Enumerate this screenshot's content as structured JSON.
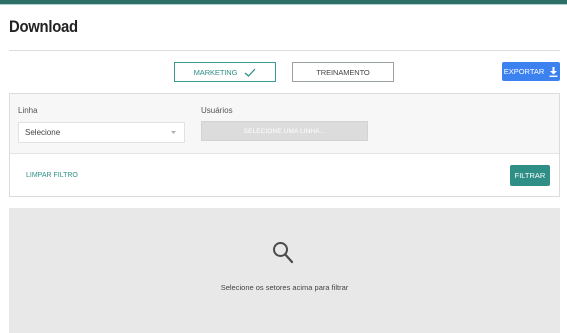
{
  "header": {
    "title": "Download"
  },
  "tabs": [
    {
      "label": "MARKETING",
      "active": true,
      "icon": "check-icon"
    },
    {
      "label": "TREINAMENTO",
      "active": false
    }
  ],
  "toolbar": {
    "export_label": "EXPORTAR",
    "export_icon": "download-icon"
  },
  "filters": {
    "linha": {
      "label": "Linha",
      "value": "Selecione"
    },
    "usuarios": {
      "label": "Usuários",
      "placeholder": "SELECIONE UMA LINHA..."
    },
    "clear_label": "LIMPAR FILTRO",
    "filter_label": "FILTRAR"
  },
  "empty_state": {
    "icon": "search-icon",
    "message": "Selecione os setores acima para filtrar"
  },
  "colors": {
    "accent": "#2f8f86",
    "primary_button": "#3b82f0",
    "top_bar": "#2f6f6a"
  }
}
